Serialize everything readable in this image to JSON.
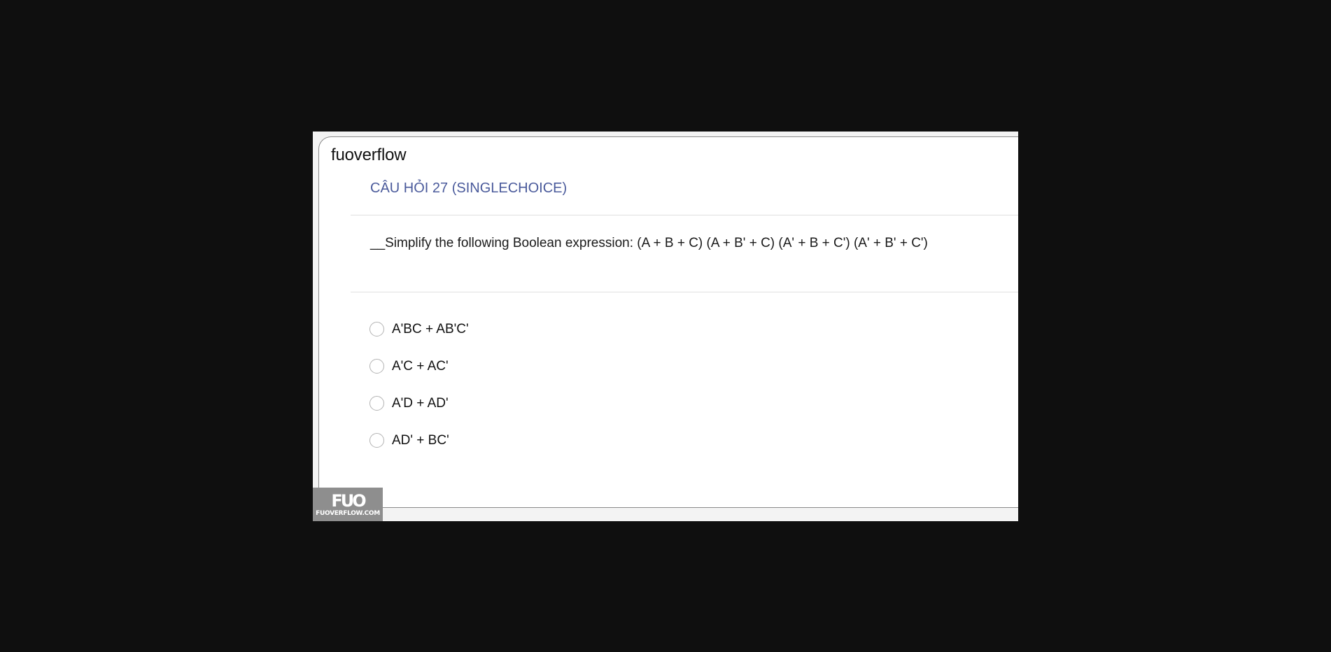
{
  "site": {
    "name": "fuoverflow"
  },
  "question": {
    "header": "CÂU HỎI 27 (SINGLECHOICE)",
    "text": "__Simplify the following Boolean expression: (A + B + C) (A + B' + C) (A' + B + C') (A' + B' + C')"
  },
  "options": [
    {
      "label": "A'BC + AB'C'",
      "selected": false
    },
    {
      "label": "A'C + AC'",
      "selected": false
    },
    {
      "label": "A'D + AD'",
      "selected": false
    },
    {
      "label": "AD' + BC'",
      "selected": false
    }
  ],
  "watermark": {
    "mark": "FUO",
    "sub": "FUOVERFLOW.COM"
  },
  "colors": {
    "background": "#0f0f0f",
    "header_accent": "#4a5a9b",
    "card": "#ffffff"
  }
}
